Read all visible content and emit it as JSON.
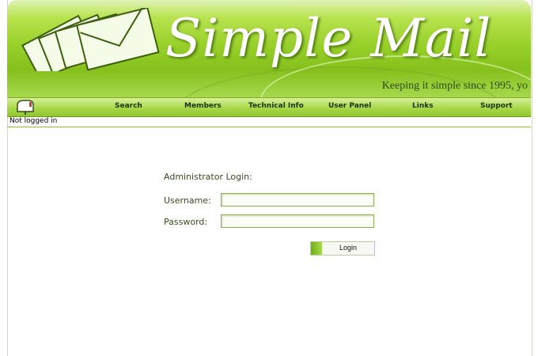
{
  "brand": {
    "title": "Simple Mail",
    "tagline": "Keeping it simple since 1995, yo"
  },
  "nav": {
    "items": [
      "Search",
      "Members",
      "Technical Info",
      "User Panel",
      "Links",
      "Support"
    ]
  },
  "status": {
    "text": "Not logged in"
  },
  "login": {
    "title": "Administrator Login:",
    "username_label": "Username:",
    "password_label": "Password:",
    "username_value": "",
    "password_value": "",
    "button_label": "Login"
  },
  "colors": {
    "accent": "#9ad12b",
    "nav": "#a8d84a",
    "text": "#3a4a1e"
  }
}
